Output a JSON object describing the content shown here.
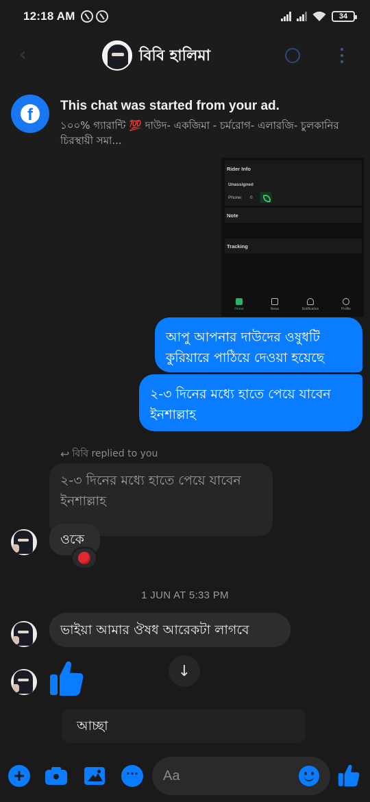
{
  "status_bar": {
    "time": "12:18 AM",
    "battery": "34"
  },
  "header": {
    "contact_name": "বিবি হালিমা"
  },
  "ad_banner": {
    "title": "This chat was started from your ad.",
    "text": "১০০% গ্যারান্টি 💯 দাউদ- একজিমা - চর্মরোগ-  এলারজি- চুলকানির চিরস্থায়ী সমা..."
  },
  "shared_screenshot": {
    "rider_info": "Rider Info",
    "unassigned": "Unassigned",
    "phone_label": "Phone:",
    "phone_value": "0",
    "note": "Note",
    "tracking": "Tracking",
    "nav": [
      "Home",
      "News",
      "Notification",
      "Profile"
    ]
  },
  "messages": {
    "out_1": "আপু আপনার দাউদের ওষুধটি কুরিয়ারে পাঠিয়ে দেওয়া হয়েছে",
    "out_2": "২-৩ দিনের মধ্যে হাতে পেয়ে যাবেন ইনশাল্লাহ",
    "replied_note": "বিবি replied to you",
    "replied_quote": "২-৩ দিনের মধ্যে হাতে পেয়ে যাবেন ইনশাল্লাহ",
    "in_1": "ওকে",
    "reaction": "heart",
    "timestamp": "1 JUN AT 5:33 PM",
    "in_2": "ভাইয়া আমার ঔষধ আরেকটা লাগবে",
    "in_3": "like",
    "draft_reply": "আচ্ছা"
  },
  "composer": {
    "placeholder": "Aa"
  },
  "colors": {
    "accent": "#0a7cff",
    "background": "#1a1a1a",
    "incoming_bubble": "#2d2d30"
  },
  "icons": [
    "back-arrow-icon",
    "video-call-icon",
    "more-icon",
    "facebook-icon",
    "reply-arrow-icon",
    "heart-icon",
    "like-icon",
    "scroll-down-icon",
    "plus-icon",
    "camera-icon",
    "gallery-icon",
    "chat-icon",
    "emoji-icon"
  ]
}
